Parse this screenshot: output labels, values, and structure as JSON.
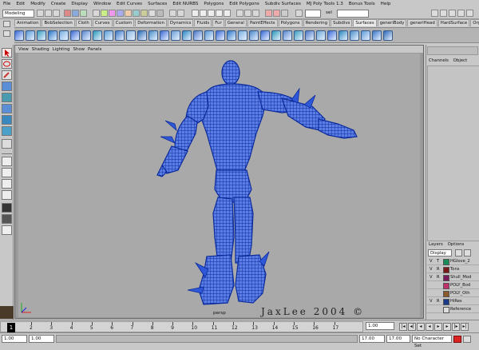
{
  "menubar": {
    "items": [
      "File",
      "Edit",
      "Modify",
      "Create",
      "Display",
      "Window",
      "Edit Curves",
      "Surfaces",
      "Edit NURBS",
      "Polygons",
      "Edit Polygons",
      "Subdiv Surfaces",
      "MJ Poly Tools 1.3",
      "Bonus Tools",
      "Help"
    ]
  },
  "statusline": {
    "mode": "Modeling",
    "sel_label": "sel"
  },
  "shelf": {
    "tabs": [
      "Animation",
      "BobSelection",
      "Cloth",
      "Curves",
      "Custom",
      "Deformation",
      "Dynamics",
      "Fluids",
      "Fur",
      "General",
      "PaintEffects",
      "Polygons",
      "Rendering",
      "Subdivs",
      "Surfaces",
      "generiBody",
      "generiHead",
      "HardSurface",
      "Organic"
    ],
    "active_tab": "Surfaces"
  },
  "viewport": {
    "menu": [
      "View",
      "Shading",
      "Lighting",
      "Show",
      "Panels"
    ],
    "camera": "persp",
    "watermark": "JaxLee 2004 ©",
    "mesh_color": "#1f4fd6"
  },
  "channelbox": {
    "tabs": [
      "Channels",
      "Object"
    ]
  },
  "layers": {
    "tabs": [
      "Layers",
      "Options"
    ],
    "display_select": "Display",
    "rows": [
      {
        "v": "V",
        "t": "T",
        "color": "#1a8c5a",
        "name": "HGlove_2"
      },
      {
        "v": "V",
        "t": "R",
        "color": "#7a1a1a",
        "name": "Tons"
      },
      {
        "v": "V",
        "t": "R",
        "color": "#7a1a5a",
        "name": "Shull_Mod"
      },
      {
        "v": "",
        "t": "",
        "color": "#c0306a",
        "name": "POLY_Bod"
      },
      {
        "v": "",
        "t": "",
        "color": "#8a5a2a",
        "name": "POLY_Oth"
      },
      {
        "v": "V",
        "t": "R",
        "color": "#1a3a8a",
        "name": "HiRes"
      },
      {
        "v": "",
        "t": "",
        "color": "#dddddd",
        "name": "Reference"
      }
    ]
  },
  "timeslider": {
    "ticks": [
      "2",
      "3",
      "4",
      "5",
      "6",
      "7",
      "8",
      "9",
      "10",
      "11",
      "12",
      "13",
      "14",
      "15",
      "16",
      "17"
    ],
    "current_frame": "1",
    "current_field": "1.00"
  },
  "rangeslider": {
    "start": "1.00",
    "start_inner": "1.00",
    "end_inner": "17.00",
    "end": "17.00",
    "character_set": "No Character Set"
  }
}
